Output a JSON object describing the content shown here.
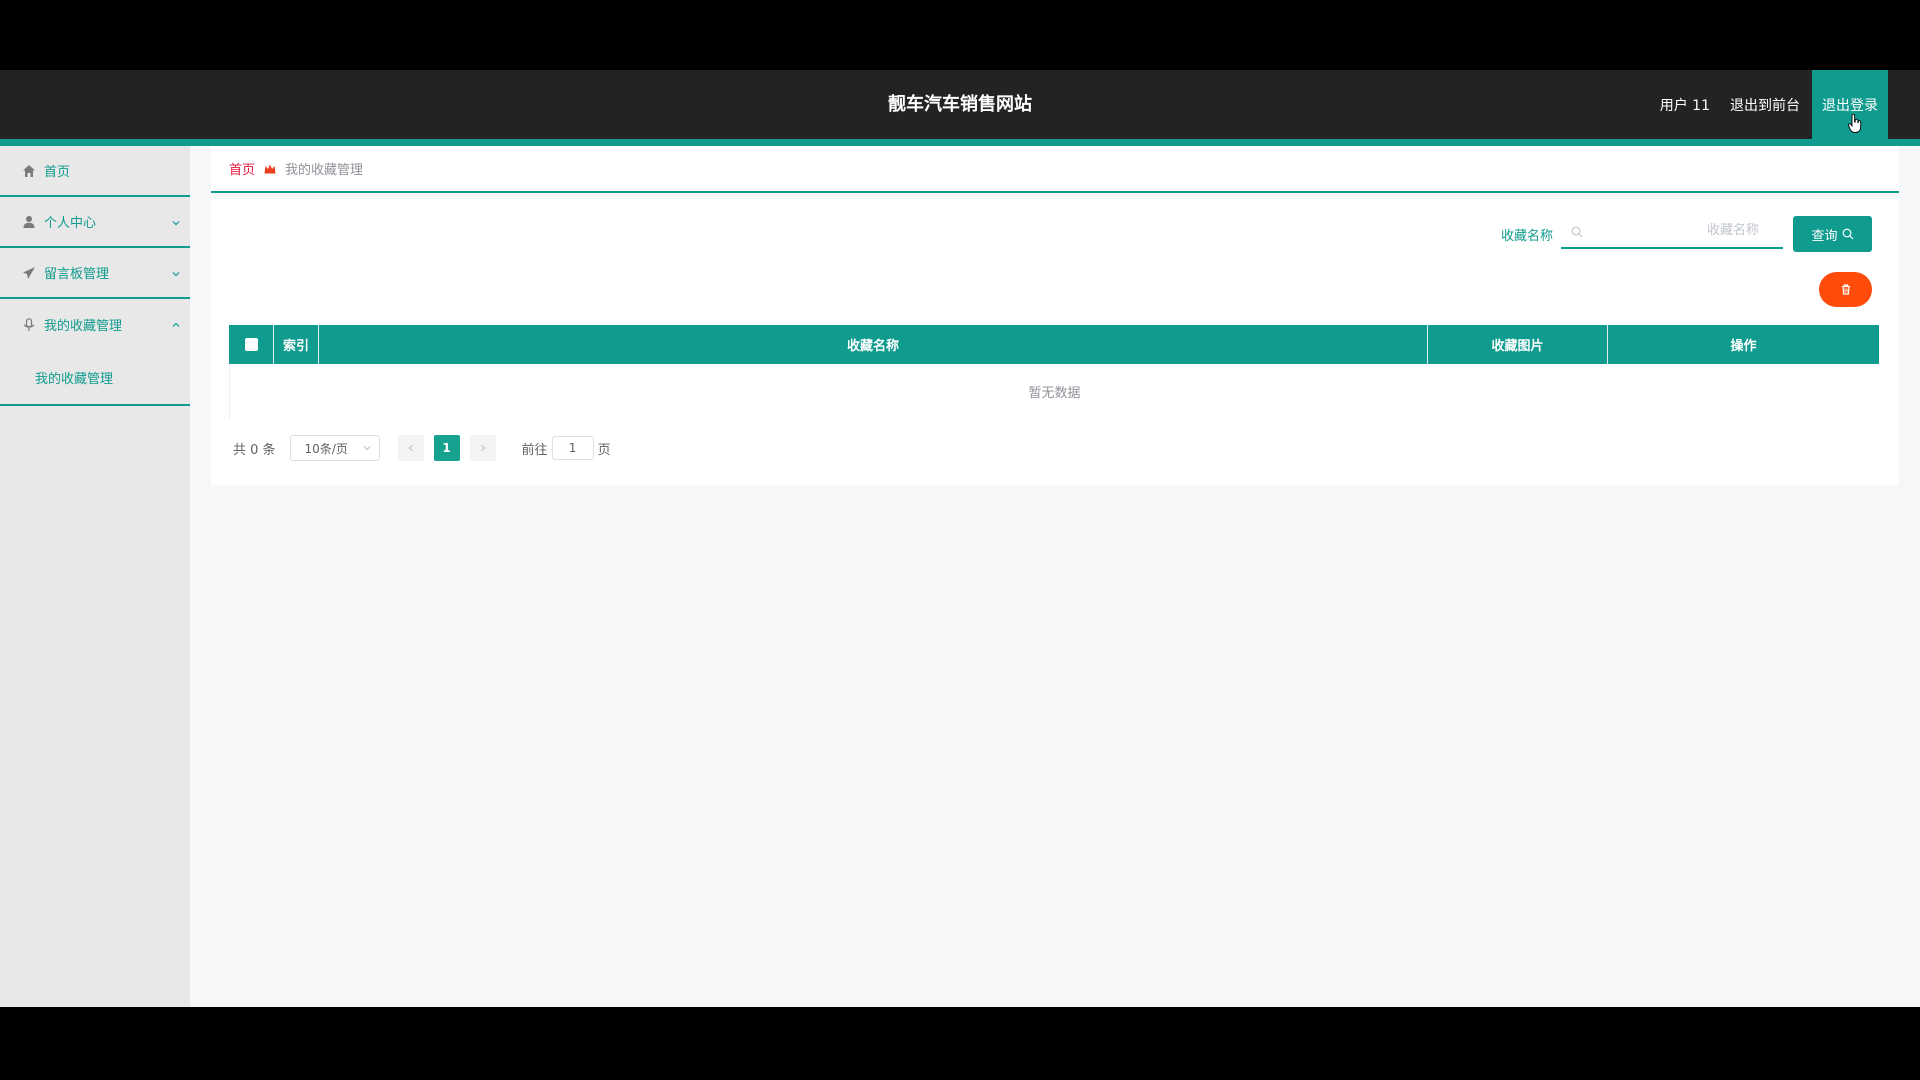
{
  "header": {
    "site_title": "靓车汽车销售网站",
    "user_label": "用户 11",
    "back_to_front": "退出到前台",
    "logout": "退出登录"
  },
  "sidebar": {
    "items": [
      {
        "label": "首页",
        "icon": "home-icon"
      },
      {
        "label": "个人中心",
        "icon": "user-icon"
      },
      {
        "label": "留言板管理",
        "icon": "send-icon"
      },
      {
        "label": "我的收藏管理",
        "icon": "microphone-icon"
      }
    ],
    "submenu_label": "我的收藏管理"
  },
  "breadcrumb": {
    "home": "首页",
    "current": "我的收藏管理"
  },
  "search": {
    "label": "收藏名称",
    "placeholder": "收藏名称",
    "value": "",
    "query_button": "查询"
  },
  "table": {
    "columns": [
      "索引",
      "收藏名称",
      "收藏图片",
      "操作"
    ],
    "empty_text": "暂无数据"
  },
  "pagination": {
    "total_text": "共 0 条",
    "page_size": "10条/页",
    "current_page": "1",
    "goto_prefix": "前往",
    "goto_value": "1",
    "goto_suffix": "页"
  },
  "colors": {
    "accent": "#0f9b8e",
    "header_bg": "#232323",
    "danger": "#ff4c0b",
    "breadcrumb_home": "#e0153d"
  }
}
